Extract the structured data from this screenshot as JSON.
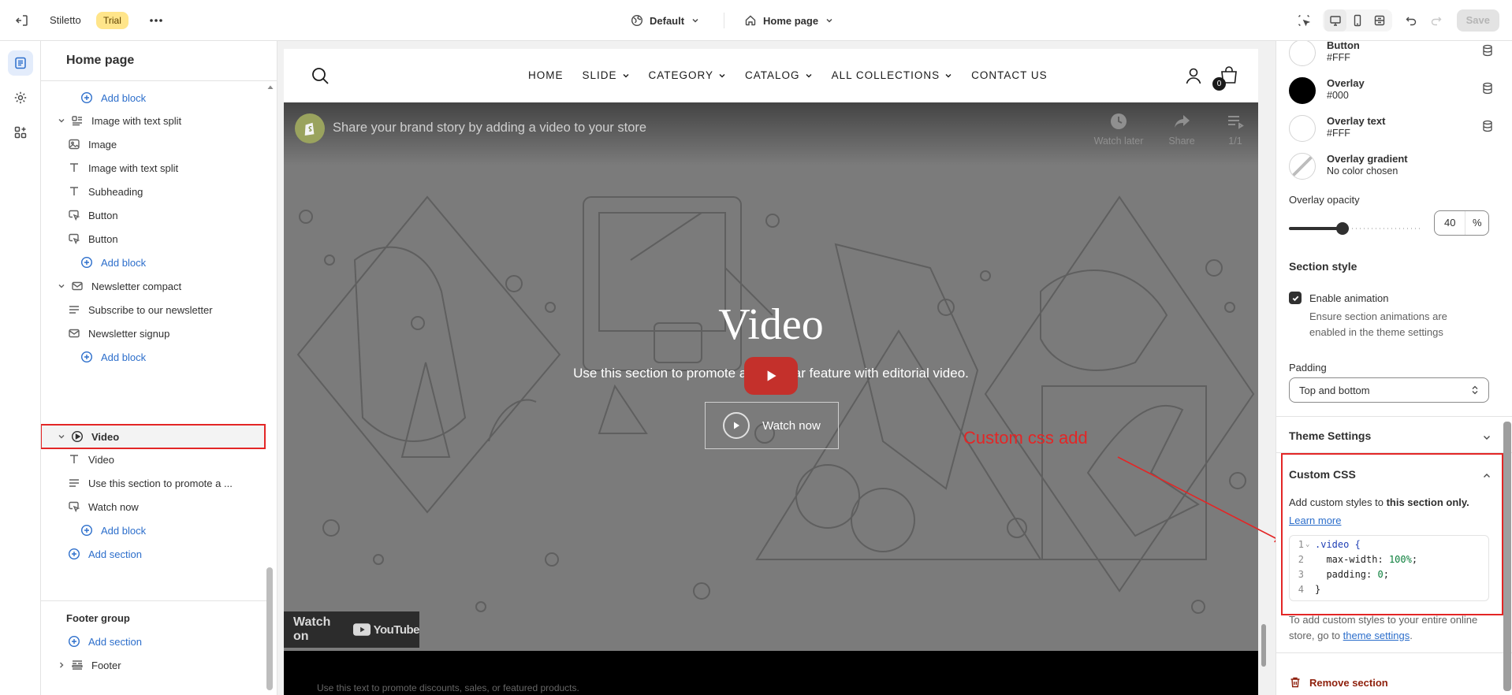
{
  "topbar": {
    "store_name": "Stiletto",
    "trial_badge": "Trial",
    "theme_selector": "Default",
    "page_selector": "Home page",
    "save_label": "Save"
  },
  "sidebar": {
    "title": "Home page",
    "items": [
      {
        "label": "Add block",
        "kind": "add"
      },
      {
        "label": "Image with text split",
        "kind": "section",
        "icon": "image-text-icon"
      },
      {
        "label": "Image",
        "kind": "block",
        "icon": "image-icon"
      },
      {
        "label": "Image with text split",
        "kind": "block",
        "icon": "text-icon"
      },
      {
        "label": "Subheading",
        "kind": "block",
        "icon": "text-icon"
      },
      {
        "label": "Button",
        "kind": "block",
        "icon": "button-icon"
      },
      {
        "label": "Button",
        "kind": "block",
        "icon": "button-icon"
      },
      {
        "label": "Add block",
        "kind": "add"
      },
      {
        "label": "Newsletter compact",
        "kind": "section",
        "icon": "mail-icon"
      },
      {
        "label": "Subscribe to our newsletter",
        "kind": "block",
        "icon": "lines-icon"
      },
      {
        "label": "Newsletter signup",
        "kind": "block",
        "icon": "mail-icon"
      },
      {
        "label": "Add block",
        "kind": "add"
      },
      {
        "label": "Video",
        "kind": "section",
        "icon": "play-circle-icon"
      },
      {
        "label": "Video",
        "kind": "block",
        "icon": "text-icon"
      },
      {
        "label": "Use this section to promote a ...",
        "kind": "block",
        "icon": "lines-icon"
      },
      {
        "label": "Watch now",
        "kind": "block",
        "icon": "button-icon"
      },
      {
        "label": "Add block",
        "kind": "add"
      },
      {
        "label": "Add section",
        "kind": "add-section"
      }
    ],
    "footer_group_title": "Footer group",
    "footer_add_section": "Add section",
    "footer_item": "Footer"
  },
  "store": {
    "nav": [
      "HOME",
      "SLIDE",
      "CATEGORY",
      "CATALOG",
      "ALL COLLECTIONS",
      "CONTACT US"
    ],
    "nav_has_dropdown": [
      false,
      true,
      true,
      true,
      true,
      false
    ],
    "cart_count": "0",
    "video_embed_title": "Share your brand story by adding a video to your store",
    "yt_controls": [
      "Watch later",
      "Share",
      "1/1"
    ],
    "video_heading": "Video",
    "video_subtext": "Use this section to promote a particular feature with editorial video.",
    "watch_now": "Watch now",
    "watch_on": "Watch on",
    "youtube": "YouTube",
    "strip_text": "Use this text to promote discounts, sales, or featured products."
  },
  "annotation": {
    "label": "Custom css add",
    "color": "#e32626"
  },
  "panel": {
    "swatches": [
      {
        "name": "Button",
        "value": "#FFF",
        "color": "#ffffff"
      },
      {
        "name": "Overlay",
        "value": "#000",
        "color": "#000000"
      },
      {
        "name": "Overlay text",
        "value": "#FFF",
        "color": "#ffffff"
      },
      {
        "name": "Overlay gradient",
        "value": "No color chosen",
        "color": "none"
      }
    ],
    "overlay_opacity_label": "Overlay opacity",
    "overlay_opacity_value": "40",
    "overlay_opacity_unit": "%",
    "section_style_heading": "Section style",
    "enable_animation_label": "Enable animation",
    "enable_animation_checked": true,
    "enable_animation_help": "Ensure section animations are enabled in the theme settings",
    "padding_label": "Padding",
    "padding_value": "Top and bottom",
    "theme_settings_heading": "Theme Settings",
    "custom_css_heading": "Custom CSS",
    "custom_css_help_prefix": "Add custom styles to ",
    "custom_css_help_bold": "this section only.",
    "learn_more": "Learn more",
    "code_lines": [
      {
        "n": "1",
        "text": ".video {"
      },
      {
        "n": "2",
        "prop": "max-width: ",
        "val": "100%",
        "end": ";"
      },
      {
        "n": "3",
        "prop": "padding: ",
        "val": "0",
        "end": ";"
      },
      {
        "n": "4",
        "text": "}"
      }
    ],
    "footer_help_prefix": "To add custom styles to your entire online store, go to ",
    "footer_help_link": "theme settings",
    "footer_help_suffix": ".",
    "remove_section": "Remove section"
  }
}
